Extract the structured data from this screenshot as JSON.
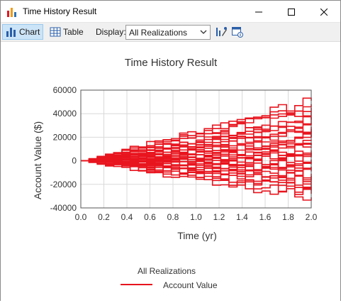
{
  "window": {
    "title": "Time History Result"
  },
  "toolbar": {
    "chart_label": "Chart",
    "table_label": "Table",
    "display_label": "Display:",
    "display_value": "All Realizations"
  },
  "chart_data": {
    "type": "line",
    "title": "Time History Result",
    "xlabel": "Time (yr)",
    "ylabel": "Account Value ($)",
    "xlim": [
      0.0,
      2.0
    ],
    "ylim": [
      -40000,
      60000
    ],
    "xticks": [
      "0.0",
      "0.2",
      "0.4",
      "0.6",
      "0.8",
      "1.0",
      "1.2",
      "1.4",
      "1.6",
      "1.8",
      "2.0"
    ],
    "yticks": [
      "60000",
      "40000",
      "20000",
      "0",
      "-20000",
      "-40000"
    ],
    "grid": true,
    "legend": {
      "title": "All Realizations",
      "position": "bottom"
    },
    "series_color": "#e8141e",
    "series": [
      {
        "name": "Account Value",
        "final_values": [
          51000,
          48000,
          45000,
          42000,
          37000,
          35000,
          32000,
          29000,
          27000,
          25000,
          22000,
          20000,
          18000,
          15000,
          13000,
          11000,
          9000,
          7000,
          5000,
          3000,
          1000,
          -1000,
          -3000,
          -5000,
          -7000,
          -9000,
          -11000,
          -13000,
          -15000,
          -18000,
          -20000,
          -22000,
          -25000,
          -28000,
          -31000
        ]
      }
    ]
  }
}
